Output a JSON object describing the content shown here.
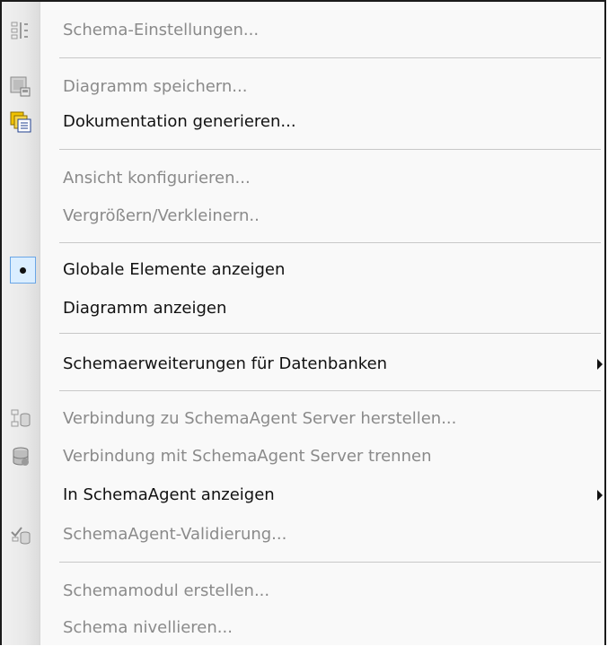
{
  "menu": {
    "items": [
      {
        "label": "Schema-Einstellungen..."
      },
      {
        "label": "Diagramm speichern..."
      },
      {
        "label": "Dokumentation generieren..."
      },
      {
        "label": "Ansicht konfigurieren..."
      },
      {
        "label": "Vergrößern/Verkleinern.."
      },
      {
        "label": "Globale Elemente anzeigen"
      },
      {
        "label": "Diagramm anzeigen"
      },
      {
        "label": "Schemaerweiterungen für Datenbanken"
      },
      {
        "label": "Verbindung zu SchemaAgent Server herstellen..."
      },
      {
        "label": "Verbindung mit SchemaAgent Server trennen"
      },
      {
        "label": "In SchemaAgent anzeigen"
      },
      {
        "label": "SchemaAgent-Validierung..."
      },
      {
        "label": "Schemamodul erstellen..."
      },
      {
        "label": "Schema nivellieren..."
      }
    ]
  },
  "icons": [
    "schema-settings-icon",
    "save-diagram-icon",
    "generate-documentation-icon",
    "connect-schemaagent-icon",
    "disconnect-schemaagent-icon",
    "schemaagent-validation-icon"
  ],
  "colors": {
    "enabled_text": "#111111",
    "disabled_text": "#8a8a8a",
    "checked_highlight": "#dbeeff",
    "checked_border": "#6aa6e6"
  }
}
